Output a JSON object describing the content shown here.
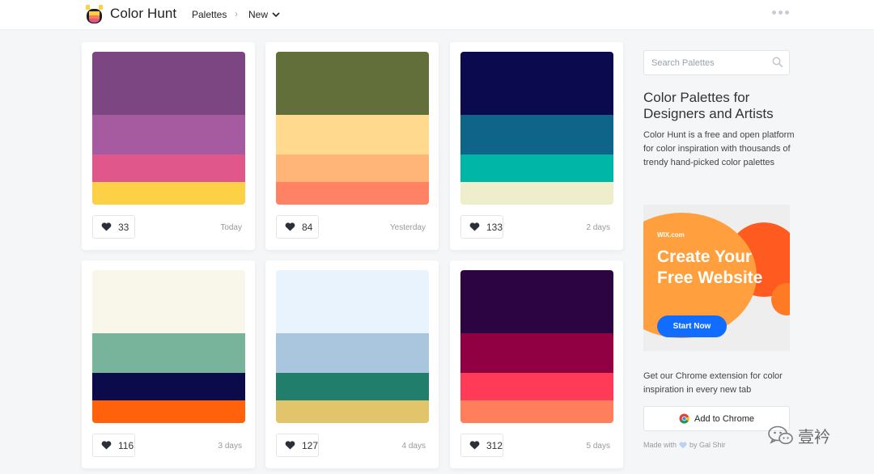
{
  "header": {
    "brand": "Color Hunt",
    "nav_palettes": "Palettes",
    "nav_separator": "›",
    "nav_new": "New"
  },
  "palettes": [
    {
      "colors": [
        "#7b4682",
        "#a65aa0",
        "#e0578c",
        "#fcd146"
      ],
      "likes": "33",
      "date": "Today"
    },
    {
      "colors": [
        "#626f3a",
        "#fed98e",
        "#ffb577",
        "#ff8264"
      ],
      "likes": "84",
      "date": "Yesterday"
    },
    {
      "colors": [
        "#0c0a4e",
        "#0e6489",
        "#00b7a7",
        "#eeedcc"
      ],
      "likes": "133",
      "date": "2 days"
    },
    {
      "colors": [
        "#f9f7e9",
        "#78b39b",
        "#0b0a4b",
        "#ff620a"
      ],
      "likes": "116",
      "date": "3 days"
    },
    {
      "colors": [
        "#e8f3fd",
        "#aac6df",
        "#207e6b",
        "#e2c46b"
      ],
      "likes": "127",
      "date": "4 days"
    },
    {
      "colors": [
        "#2d0442",
        "#900042",
        "#ff3b57",
        "#ff7f5c"
      ],
      "likes": "312",
      "date": "5 days"
    }
  ],
  "sidebar": {
    "search_placeholder": "Search Palettes",
    "title": "Color Palettes for Designers and Artists",
    "description": "Color Hunt is a free and open platform for color inspiration with thousands of trendy hand-picked color palettes",
    "ad": {
      "brand": "WIX.com",
      "headline": "Create Your Free Website",
      "button": "Start Now"
    },
    "extension_text": "Get our Chrome extension for color inspiration in every new tab",
    "chrome_button": "Add to Chrome",
    "made_with_prefix": "Made with",
    "made_with_suffix": "by Gal Shir"
  },
  "watermark": "壹衿",
  "colors": {
    "accent_blue": "#116dff",
    "heart": "#2b2f38"
  }
}
